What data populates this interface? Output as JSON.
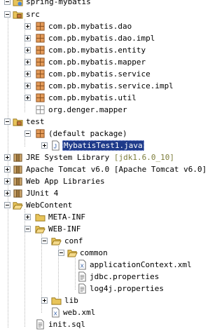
{
  "project": {
    "name": "spring-mybatis",
    "src": {
      "label": "src",
      "packages": [
        "com.pb.mybatis.dao",
        "com.pb.mybatis.dao.impl",
        "com.pb.mybatis.entity",
        "com.pb.mybatis.mapper",
        "com.pb.mybatis.service",
        "com.pb.mybatis.service.impl",
        "com.pb.mybatis.util",
        "org.denger.mapper"
      ]
    },
    "test": {
      "label": "test",
      "default_package": "(default package)",
      "file": "MybatisTest1.java"
    },
    "libraries": [
      {
        "label": "JRE System Library",
        "decoration": "[jdk1.6.0_10]"
      },
      {
        "label": "Apache Tomcat v6.0",
        "decoration": "[Apache Tomcat v6.0]"
      },
      {
        "label": "Web App Libraries",
        "decoration": ""
      },
      {
        "label": "JUnit 4",
        "decoration": ""
      }
    ],
    "webcontent": {
      "label": "WebContent",
      "meta_inf": "META-INF",
      "web_inf": "WEB-INF",
      "conf": "conf",
      "common": "common",
      "common_files": [
        "applicationContext.xml",
        "jdbc.properties",
        "log4j.properties"
      ],
      "lib": "lib",
      "web_xml": "web.xml"
    },
    "init_sql": "init.sql"
  }
}
